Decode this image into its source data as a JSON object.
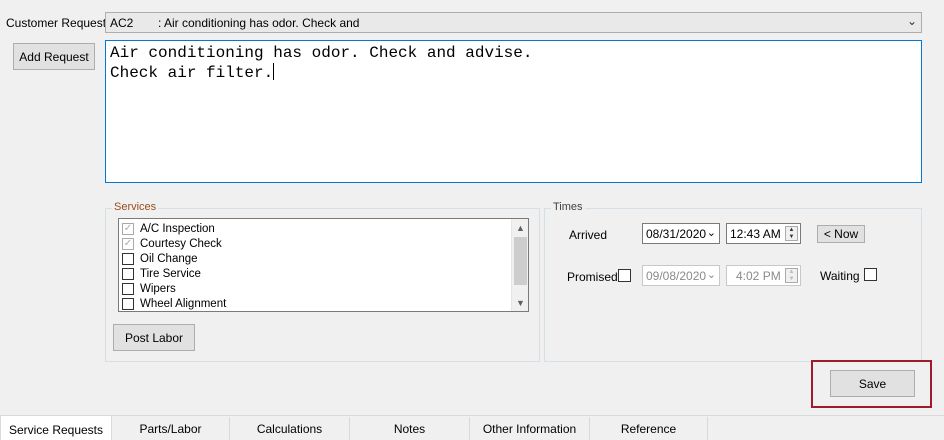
{
  "customer_request": {
    "label": "Customer Request:",
    "code": "AC2",
    "text": ":  Air conditioning has odor.  Check and"
  },
  "add_request_label": "Add Request",
  "notes_text": "Air conditioning has odor. Check and advise.\nCheck air filter.",
  "services": {
    "title": "Services",
    "items": [
      {
        "label": "A/C Inspection",
        "checked": true
      },
      {
        "label": "Courtesy Check",
        "checked": true
      },
      {
        "label": "Oil Change",
        "checked": false
      },
      {
        "label": "Tire Service",
        "checked": false
      },
      {
        "label": "Wipers",
        "checked": false
      },
      {
        "label": "Wheel Alignment",
        "checked": false
      }
    ],
    "post_labor_label": "Post Labor"
  },
  "times": {
    "title": "Times",
    "arrived_label": "Arrived",
    "arrived_date": "08/31/2020",
    "arrived_time": "12:43 AM",
    "now_label": "< Now",
    "promised_label": "Promised",
    "promised_checked": false,
    "promised_date": "09/08/2020",
    "promised_time": "4:02 PM",
    "waiting_label": "Waiting",
    "waiting_checked": false
  },
  "save_label": "Save",
  "tabs": [
    {
      "label": "Service Requests",
      "active": true
    },
    {
      "label": "Parts/Labor",
      "active": false
    },
    {
      "label": "Calculations",
      "active": false
    },
    {
      "label": "Notes",
      "active": false
    },
    {
      "label": "Other Information",
      "active": false
    },
    {
      "label": "Reference",
      "active": false
    }
  ],
  "colors": {
    "save_highlight": "#9e1c2b",
    "focus_border": "#0078d7",
    "services_title": "#9a4d1a"
  }
}
